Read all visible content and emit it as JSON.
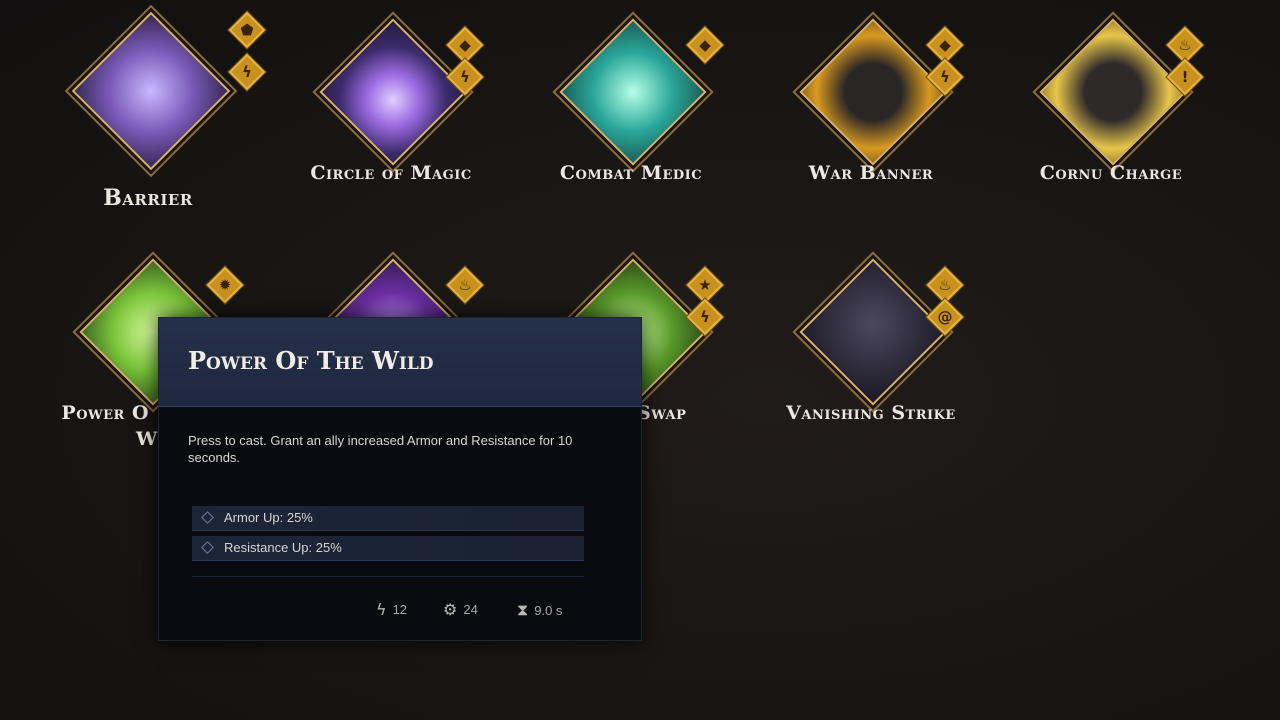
{
  "skills": [
    {
      "name": "Barrier",
      "badges": [
        "shield",
        "lightning"
      ],
      "art": "#7a5ab8",
      "size": "big"
    },
    {
      "name": "Circle of Magic",
      "badges": [
        "gem",
        "lightning"
      ],
      "art": "#3b2a6a"
    },
    {
      "name": "Combat Medic",
      "badges": [
        "gem"
      ],
      "art": "#2aa79a"
    },
    {
      "name": "War Banner",
      "badges": [
        "gem",
        "lightning"
      ],
      "art": "#d99a1f"
    },
    {
      "name": "Cornu Charge",
      "badges": [
        "fire",
        "exclamation"
      ],
      "art": "#e8c64a"
    },
    {
      "name": "Power Of The Wild",
      "name_visible": "Power O",
      "name_line2": "Wil",
      "badges": [
        "gear"
      ],
      "art": "#7cc43a"
    },
    {
      "name": "",
      "badges": [
        "fire"
      ],
      "art": "#6b2fa3"
    },
    {
      "name_visible": "Swap",
      "badges": [
        "star",
        "lightning"
      ],
      "art": "#5a9a2a"
    },
    {
      "name": "Vanishing Strike",
      "badges": [
        "fire",
        "spiral"
      ],
      "art": "#3a3648"
    }
  ],
  "tooltip": {
    "title": "Power Of The Wild",
    "description": "Press to cast. Grant an ally increased Armor and Resistance for 10 seconds.",
    "stats": [
      "Armor Up: 25%",
      "Resistance Up: 25%"
    ],
    "costs": {
      "energy": "12",
      "cooldown_points": "24",
      "duration": "9.0 s"
    }
  },
  "icons": {
    "shield": "shield-icon",
    "lightning": "lightning-icon",
    "gem": "gem-icon",
    "fire": "fire-icon",
    "exclamation": "exclamation-icon",
    "gear": "gear-icon",
    "star": "star-icon",
    "spiral": "spiral-icon"
  }
}
